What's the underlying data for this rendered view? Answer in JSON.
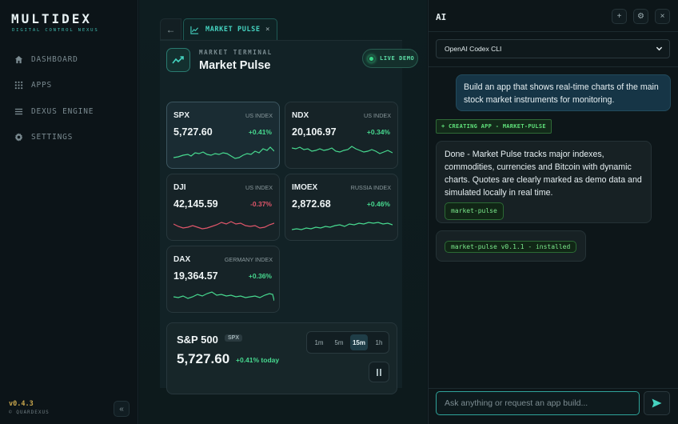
{
  "sidebar": {
    "logo": "MULTIDEX",
    "logo_sub": "DIGITAL CONTROL NEXUS",
    "items": [
      {
        "label": "DASHBOARD",
        "icon": "home-icon"
      },
      {
        "label": "APPS",
        "icon": "grid-icon"
      },
      {
        "label": "DEXUS ENGINE",
        "icon": "menu-icon"
      },
      {
        "label": "SETTINGS",
        "icon": "gear-icon"
      }
    ],
    "version": "v0.4.3",
    "copyright": "© QUARDEXUS",
    "collapse_label": "«"
  },
  "tabbar": {
    "back_label": "←",
    "tab_label": "MARKET PULSE",
    "close_label": "×"
  },
  "app": {
    "kicker": "MARKET TERMINAL",
    "title": "Market Pulse",
    "badge": "LIVE DEMO",
    "cards": [
      {
        "symbol": "SPX",
        "category": "US INDEX",
        "price": "5,727.60",
        "change": "+0.41%",
        "trend": "up"
      },
      {
        "symbol": "NDX",
        "category": "US INDEX",
        "price": "20,106.97",
        "change": "+0.34%",
        "trend": "up"
      },
      {
        "symbol": "DJI",
        "category": "US INDEX",
        "price": "42,145.59",
        "change": "-0.37%",
        "trend": "down"
      },
      {
        "symbol": "IMOEX",
        "category": "RUSSIA INDEX",
        "price": "2,872.68",
        "change": "+0.46%",
        "trend": "up"
      },
      {
        "symbol": "DAX",
        "category": "GERMANY INDEX",
        "price": "19,364.57",
        "change": "+0.36%",
        "trend": "up"
      }
    ],
    "detail": {
      "name": "S&P 500",
      "symbol": "SPX",
      "price": "5,727.60",
      "change": "+0.41% today",
      "timeframes": [
        "1m",
        "5m",
        "15m",
        "1h"
      ],
      "selected_timeframe": "15m"
    }
  },
  "ai": {
    "title": "AI",
    "header_buttons": [
      "+",
      "⚙",
      "×"
    ],
    "model": "OpenAI Codex CLI",
    "messages": {
      "user": "Build an app that shows real-time charts of the main stock market instruments for monitoring.",
      "tag": "+ CREATING APP - MARKET-PULSE",
      "bot": "Done - Market Pulse tracks major indexes, commodities, currencies and Bitcoin with dynamic charts. Quotes are clearly marked as demo data and simulated locally in real time.",
      "bot_code": "market-pulse",
      "installed": "market-pulse v0.1.1 - installed"
    },
    "input_placeholder": "Ask anything or request an app build..."
  },
  "colors": {
    "accent": "#45d3c0",
    "up": "#47d98f",
    "down": "#e0566a",
    "version": "#c8a64d"
  }
}
